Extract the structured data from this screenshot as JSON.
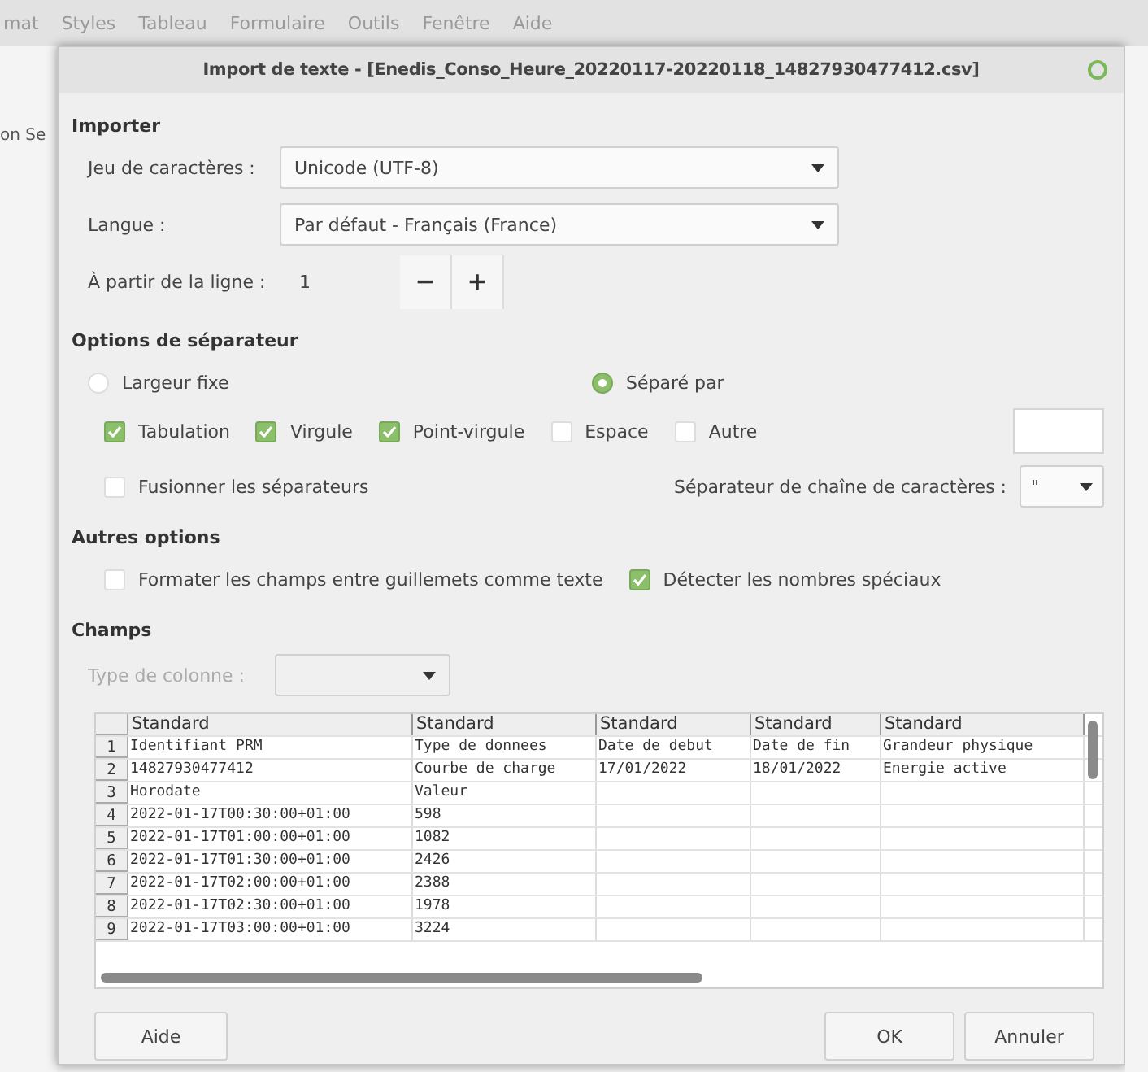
{
  "app_menu": [
    "mat",
    "Styles",
    "Tableau",
    "Formulaire",
    "Outils",
    "Fenêtre",
    "Aide"
  ],
  "background_text": "on Se",
  "dialog": {
    "title": "Import de texte - [Enedis_Conso_Heure_20220117-20220118_14827930477412.csv]",
    "importer": {
      "heading": "Importer",
      "charset": {
        "label": "Jeu de caractères :",
        "value": "Unicode (UTF-8)"
      },
      "language": {
        "label": "Langue :",
        "value": "Par défaut - Français (France)"
      },
      "from_line": {
        "label": "À partir de la ligne :",
        "value": "1",
        "minus": "−",
        "plus": "+"
      }
    },
    "separator_options": {
      "heading": "Options de séparateur",
      "modes": [
        {
          "label": "Largeur fixe",
          "selected": false
        },
        {
          "label": "Séparé par",
          "selected": true
        }
      ],
      "separators": [
        {
          "label": "Tabulation",
          "checked": true
        },
        {
          "label": "Virgule",
          "checked": true
        },
        {
          "label": "Point-virgule",
          "checked": true
        },
        {
          "label": "Espace",
          "checked": false
        },
        {
          "label": "Autre",
          "checked": false
        }
      ],
      "merge": {
        "label": "Fusionner les séparateurs",
        "checked": false
      },
      "string_delimiter": {
        "label": "Séparateur de chaîne de caractères :",
        "value": "\""
      }
    },
    "other_options": {
      "heading": "Autres options",
      "options": [
        {
          "label": "Formater les champs entre guillemets comme texte",
          "checked": false
        },
        {
          "label": "Détecter les nombres spéciaux",
          "checked": true
        }
      ]
    },
    "fields": {
      "heading": "Champs",
      "column_type": {
        "label": "Type de colonne :",
        "disabled": true
      },
      "table": {
        "columns": [
          "Standard",
          "Standard",
          "Standard",
          "Standard",
          "Standard"
        ],
        "rows": [
          {
            "number": "1",
            "cells": [
              "Identifiant PRM",
              "Type de donnees",
              "Date de debut",
              "Date de fin",
              "Grandeur physique"
            ]
          },
          {
            "number": "2",
            "cells": [
              "14827930477412",
              "Courbe de charge",
              "17/01/2022",
              "18/01/2022",
              "Energie active"
            ]
          },
          {
            "number": "3",
            "cells": [
              "Horodate",
              "Valeur",
              "",
              "",
              ""
            ]
          },
          {
            "number": "4",
            "cells": [
              "2022-01-17T00:30:00+01:00",
              "598",
              "",
              "",
              ""
            ]
          },
          {
            "number": "5",
            "cells": [
              "2022-01-17T01:00:00+01:00",
              "1082",
              "",
              "",
              ""
            ]
          },
          {
            "number": "6",
            "cells": [
              "2022-01-17T01:30:00+01:00",
              "2426",
              "",
              "",
              ""
            ]
          },
          {
            "number": "7",
            "cells": [
              "2022-01-17T02:00:00+01:00",
              "2388",
              "",
              "",
              ""
            ]
          },
          {
            "number": "8",
            "cells": [
              "2022-01-17T02:30:00+01:00",
              "1978",
              "",
              "",
              ""
            ]
          },
          {
            "number": "9",
            "cells": [
              "2022-01-17T03:00:00+01:00",
              "3224",
              "",
              "",
              ""
            ]
          }
        ]
      }
    },
    "buttons": [
      {
        "label": "Aide",
        "kind": "help"
      },
      {
        "label": "OK",
        "kind": "action"
      },
      {
        "label": "Annuler",
        "kind": "action"
      }
    ]
  }
}
